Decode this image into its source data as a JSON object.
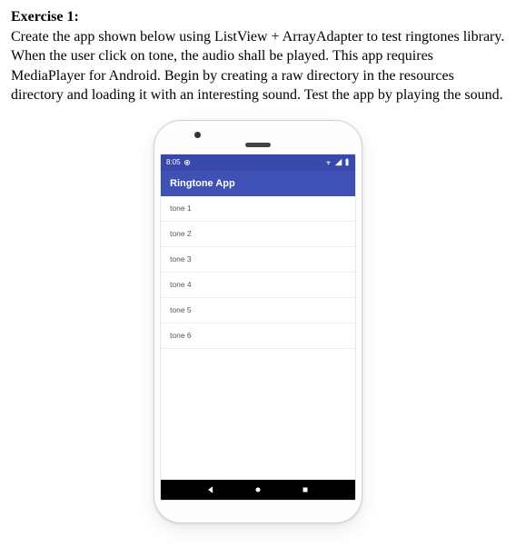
{
  "exercise": {
    "title": "Exercise 1:",
    "body": "Create the app shown below using ListView + ArrayAdapter to test ringtones library. When the user click on tone, the audio shall be played. This app requires MediaPlayer for Android. Begin by creating a raw directory in the resources directory and loading it with an interesting sound. Test the app by playing the sound."
  },
  "phone": {
    "status_time": "8:05",
    "app_title": "Ringtone App",
    "list_items": [
      "tone 1",
      "tone 2",
      "tone 3",
      "tone 4",
      "tone 5",
      "tone 6"
    ]
  },
  "colors": {
    "status_bar": "#3949ab",
    "app_bar": "#3f51b5"
  }
}
